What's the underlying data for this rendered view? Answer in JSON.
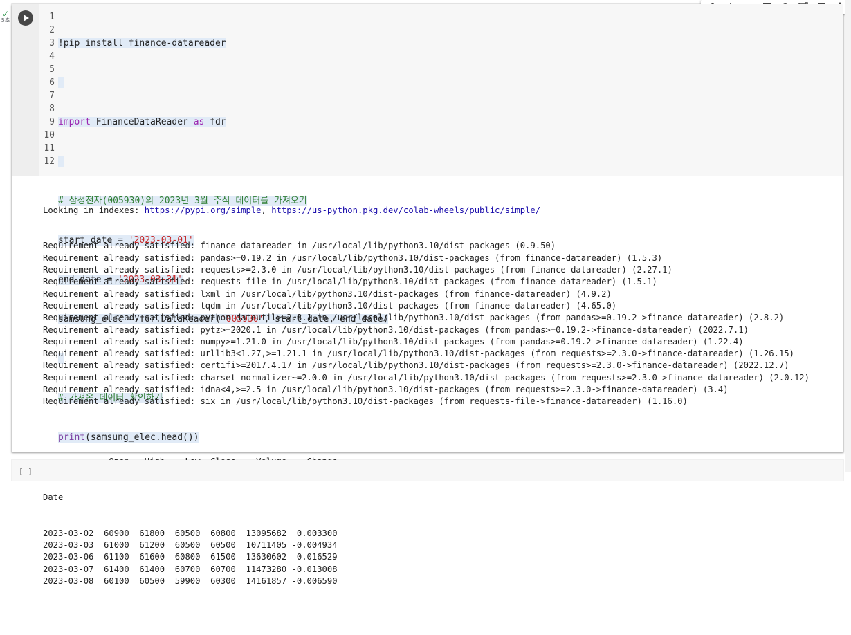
{
  "exec": {
    "check": "✓",
    "time": "5초"
  },
  "toolbar": {
    "icons": [
      "arrow-up-icon",
      "arrow-down-icon",
      "link-icon",
      "comment-icon",
      "gear-icon",
      "mirror-cell-icon",
      "delete-icon",
      "more-vert-icon"
    ]
  },
  "code": {
    "line_numbers": [
      "1",
      "2",
      "3",
      "4",
      "5",
      "6",
      "7",
      "8",
      "9",
      "10",
      "11",
      "12"
    ],
    "line1": "!pip install finance-datareader",
    "line3_kw": "import",
    "line3_mid": " FinanceDataReader ",
    "line3_as": "as",
    "line3_end": " fdr",
    "line5": "# 삼성전자(005930)의 2023년 3월 주식 데이터를 가져오기",
    "line6_a": "start_date = ",
    "line6_s": "'2023-03-01'",
    "line7_a": "end_date = ",
    "line7_s": "'2023-03-31'",
    "line8_a": "samsung_elec = fdr.DataReader(",
    "line8_s": "'005930'",
    "line8_b": ", start_date, end_date)",
    "line10": "# 가져온 데이터 확인하기",
    "line11_fn": "print",
    "line11_rest": "(samsung_elec.head())"
  },
  "output": {
    "looking_prefix": "Looking in indexes: ",
    "link1": "https://pypi.org/simple",
    "sep": ", ",
    "link2": "https://us-python.pkg.dev/colab-wheels/public/simple/",
    "requirements": [
      "Requirement already satisfied: finance-datareader in /usr/local/lib/python3.10/dist-packages (0.9.50)",
      "Requirement already satisfied: pandas>=0.19.2 in /usr/local/lib/python3.10/dist-packages (from finance-datareader) (1.5.3)",
      "Requirement already satisfied: requests>=2.3.0 in /usr/local/lib/python3.10/dist-packages (from finance-datareader) (2.27.1)",
      "Requirement already satisfied: requests-file in /usr/local/lib/python3.10/dist-packages (from finance-datareader) (1.5.1)",
      "Requirement already satisfied: lxml in /usr/local/lib/python3.10/dist-packages (from finance-datareader) (4.9.2)",
      "Requirement already satisfied: tqdm in /usr/local/lib/python3.10/dist-packages (from finance-datareader) (4.65.0)",
      "Requirement already satisfied: python-dateutil>=2.8.1 in /usr/local/lib/python3.10/dist-packages (from pandas>=0.19.2->finance-datareader) (2.8.2)",
      "Requirement already satisfied: pytz>=2020.1 in /usr/local/lib/python3.10/dist-packages (from pandas>=0.19.2->finance-datareader) (2022.7.1)",
      "Requirement already satisfied: numpy>=1.21.0 in /usr/local/lib/python3.10/dist-packages (from pandas>=0.19.2->finance-datareader) (1.22.4)",
      "Requirement already satisfied: urllib3<1.27,>=1.21.1 in /usr/local/lib/python3.10/dist-packages (from requests>=2.3.0->finance-datareader) (1.26.15)",
      "Requirement already satisfied: certifi>=2017.4.17 in /usr/local/lib/python3.10/dist-packages (from requests>=2.3.0->finance-datareader) (2022.12.7)",
      "Requirement already satisfied: charset-normalizer~=2.0.0 in /usr/local/lib/python3.10/dist-packages (from requests>=2.3.0->finance-datareader) (2.0.12)",
      "Requirement already satisfied: idna<4,>=2.5 in /usr/local/lib/python3.10/dist-packages (from requests>=2.3.0->finance-datareader) (3.4)",
      "Requirement already satisfied: six in /usr/local/lib/python3.10/dist-packages (from requests-file->finance-datareader) (1.16.0)"
    ],
    "table": {
      "header": "             Open   High    Low  Close    Volume    Change",
      "index_name": "Date",
      "rows": [
        "2023-03-02  60900  61800  60500  60800  13095682  0.003300",
        "2023-03-03  61000  61200  60500  60500  10711405 -0.004934",
        "2023-03-06  61100  61600  60800  61500  13630602  0.016529",
        "2023-03-07  61400  61400  60700  60700  11473280 -0.013008",
        "2023-03-08  60100  60500  59900  60300  14161857 -0.006590"
      ]
    }
  },
  "next_cell": {
    "bracket": "[ ]"
  }
}
